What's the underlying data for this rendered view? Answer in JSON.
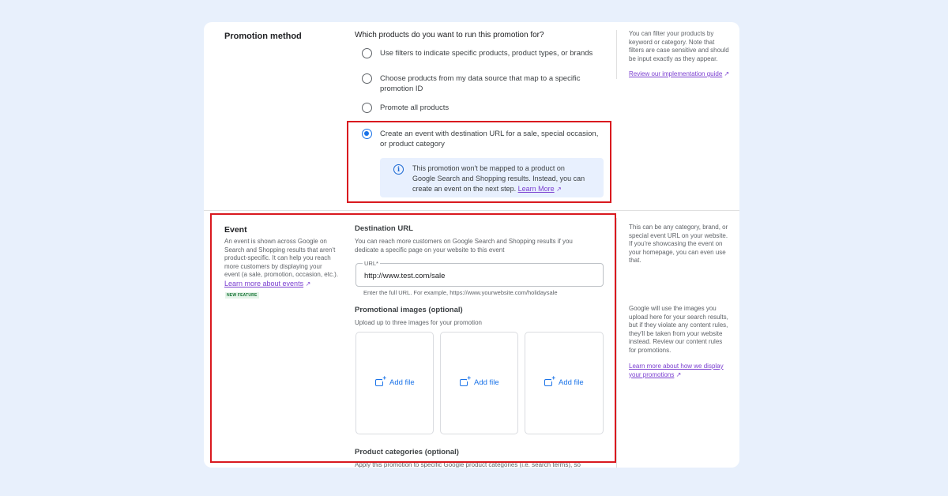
{
  "promotion": {
    "title": "Promotion method",
    "question": "Which products do you want to run this promotion for?",
    "options": [
      {
        "line1": "Use filters to indicate specific products, product types, or brands",
        "line2": ""
      },
      {
        "line1": "Choose products from my data source that map to a specific",
        "line2": "promotion ID"
      },
      {
        "line1": "Promote all products",
        "line2": ""
      },
      {
        "line1": "Create an event with destination URL for a sale, special occasion,",
        "line2": "or product category"
      }
    ],
    "selected_index": 3,
    "info": {
      "icon": "info-icon",
      "line1": "This promotion won't be mapped to a product on",
      "line2": "Google Search and Shopping results. Instead, you can",
      "line3": "create an event on the next step.",
      "link": "Learn More"
    },
    "side_lines": [
      "You can filter your products by",
      "keyword or category. Note that",
      "filters are case sensitive and should",
      "be input exactly as they appear."
    ],
    "side_link": "Review our implementation guide"
  },
  "event": {
    "title": "Event",
    "desc_lines": [
      "An event is shown across Google on",
      "Search and Shopping results that aren't",
      "product-specific. It can help you reach",
      "more customers by displaying your",
      "event (a sale, promotion, occasion, etc.)."
    ],
    "learn_link": "Learn more about events",
    "badge": "NEW FEATURE",
    "dest_title": "Destination URL",
    "dest_desc_lines": [
      "You can reach more customers on Google Search and Shopping results if you",
      "dedicate a specific page on your website to this event"
    ],
    "url_label": "URL*",
    "url_value": "http://www.test.com/sale",
    "url_hint": "Enter the full URL. For example, https://www.yourwebsite.com/holidaysale",
    "images_title": "Promotional images (optional)",
    "images_desc": "Upload up to three images for your promotion",
    "add_file": "Add file",
    "categories_title": "Product categories (optional)",
    "categories_desc": "Apply this promotion to specific Google product categories (i.e. search terms), so",
    "side1_lines": [
      "This can be any category, brand, or",
      "special event URL on your website.",
      "If you're showcasing the event on",
      "your homepage, you can even use",
      "that."
    ],
    "side2_lines": [
      "Google will use the images you",
      "upload here for your search results,",
      "but if they violate any content rules,",
      "they'll be taken from your website",
      "instead. Review our content rules",
      "for promotions."
    ],
    "side2_link_lines": [
      "Learn more about how we display",
      "your promotions"
    ]
  },
  "colors": {
    "highlight": "#d9191f",
    "accent": "#1a73e8",
    "link": "#7b3fd0",
    "background": "#e8f0fc"
  }
}
